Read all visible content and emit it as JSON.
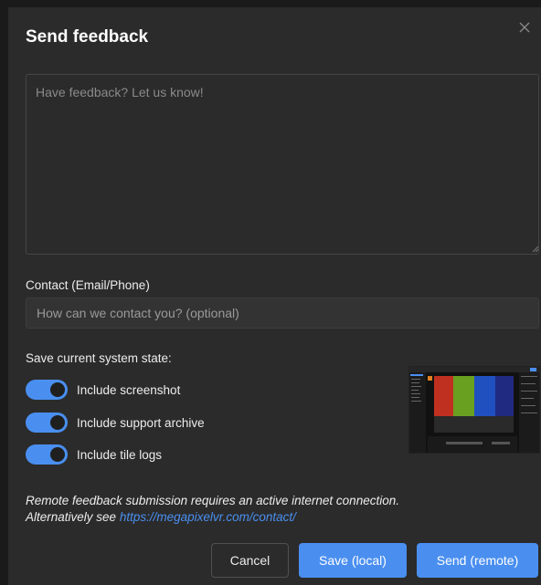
{
  "dialog": {
    "title": "Send feedback",
    "close_icon": "close-icon"
  },
  "feedback": {
    "placeholder": "Have feedback? Let us know!",
    "value": ""
  },
  "contact": {
    "label": "Contact (Email/Phone)",
    "placeholder": "How can we contact you? (optional)",
    "value": ""
  },
  "system_state": {
    "label": "Save current system state:",
    "toggles": [
      {
        "label": "Include screenshot",
        "on": true
      },
      {
        "label": "Include support archive",
        "on": true
      },
      {
        "label": "Include tile logs",
        "on": true
      }
    ],
    "preview_icon": "screenshot-thumbnail"
  },
  "notice": {
    "line1": "Remote feedback submission requires an active internet connection.",
    "line2_prefix": "Alternatively see ",
    "link": "https://megapixelvr.com/contact/"
  },
  "buttons": {
    "cancel": "Cancel",
    "save_local": "Save (local)",
    "send_remote": "Send (remote)"
  },
  "colors": {
    "background": "#2b2b2b",
    "accent": "#4a8ff0",
    "text": "#ededed"
  }
}
